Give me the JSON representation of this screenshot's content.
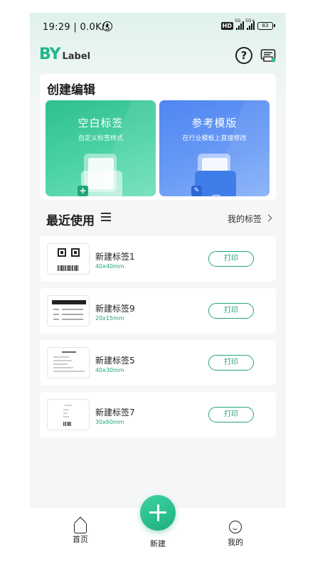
{
  "status_bar": {
    "time": "19:29 | 0.0K/s",
    "hd": "HD",
    "sig1": "5G",
    "sig2": "5G+",
    "battery": "83"
  },
  "header": {
    "logo_main": "BY",
    "logo_sub": "Label",
    "help_glyph": "?",
    "printer_icon": "printer-icon"
  },
  "create": {
    "title": "创建编辑",
    "blank": {
      "title": "空白标签",
      "subtitle": "自定义标签样式",
      "badge": "+"
    },
    "template": {
      "title": "参考模版",
      "subtitle": "在行业模板上直接修改",
      "badge": "✎"
    }
  },
  "recent": {
    "title": "最近使用",
    "my_labels": "我的标签"
  },
  "items": [
    {
      "name": "新建标签1",
      "size": "40x40mm",
      "print": "打印"
    },
    {
      "name": "新建标签9",
      "size": "20x15mm",
      "print": "打印"
    },
    {
      "name": "新建标签5",
      "size": "40x30mm",
      "print": "打印"
    },
    {
      "name": "新建标签7",
      "size": "30x60mm",
      "print": "打印"
    }
  ],
  "nav": {
    "home": "首页",
    "new": "新建",
    "me": "我的"
  },
  "colors": {
    "accent": "#22a57b",
    "blank_tile": "#2fbf8f",
    "template_tile": "#4f86f0"
  }
}
